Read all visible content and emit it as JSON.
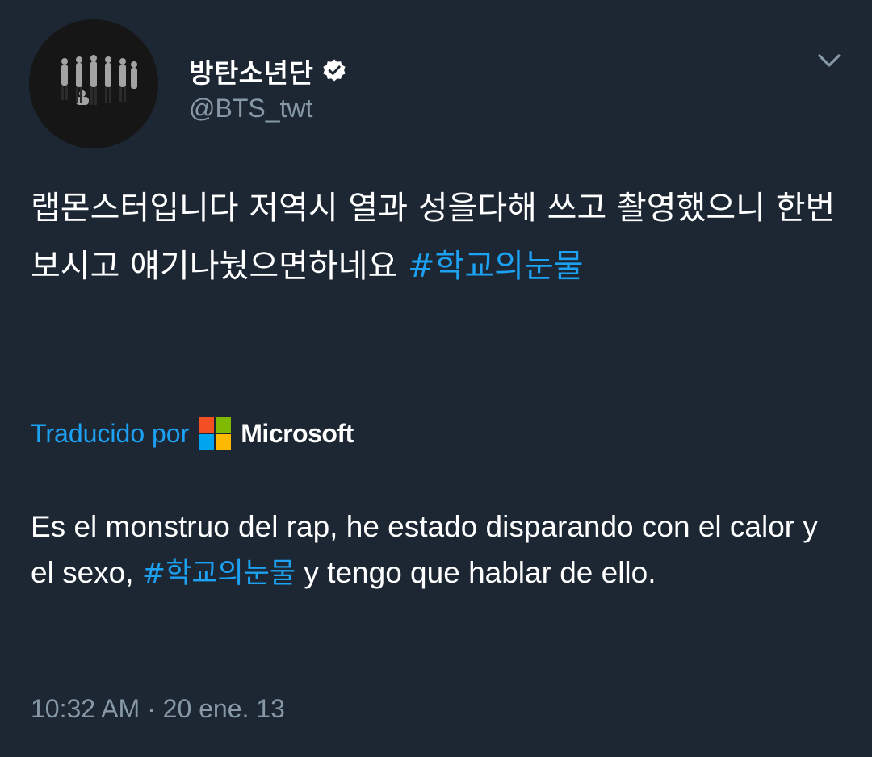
{
  "author": {
    "display_name": "방탄소년단",
    "handle": "@BTS_twt",
    "verified_icon": "verified-badge-icon"
  },
  "tweet": {
    "text_before": "랩몬스터입니다 저역시 열과 성을다해 쓰고 촬영했으니 한번 보시고 얘기나눴으면하네요 ",
    "hashtag": "#학교의눈물"
  },
  "translation": {
    "label": "Traducido por",
    "provider": "Microsoft",
    "text_before": "Es el monstruo del rap, he estado disparando con el calor y el sexo, ",
    "hashtag": "#학교의눈물",
    "text_after": " y tengo que hablar de ello."
  },
  "meta": {
    "timestamp": "10:32 AM · 20 ene. 13"
  },
  "colors": {
    "background": "#1c2733",
    "link": "#1da1f2",
    "secondary_text": "#8899a6",
    "ms_red": "#f25022",
    "ms_green": "#7fba00",
    "ms_blue": "#00a4ef",
    "ms_yellow": "#ffb900"
  }
}
